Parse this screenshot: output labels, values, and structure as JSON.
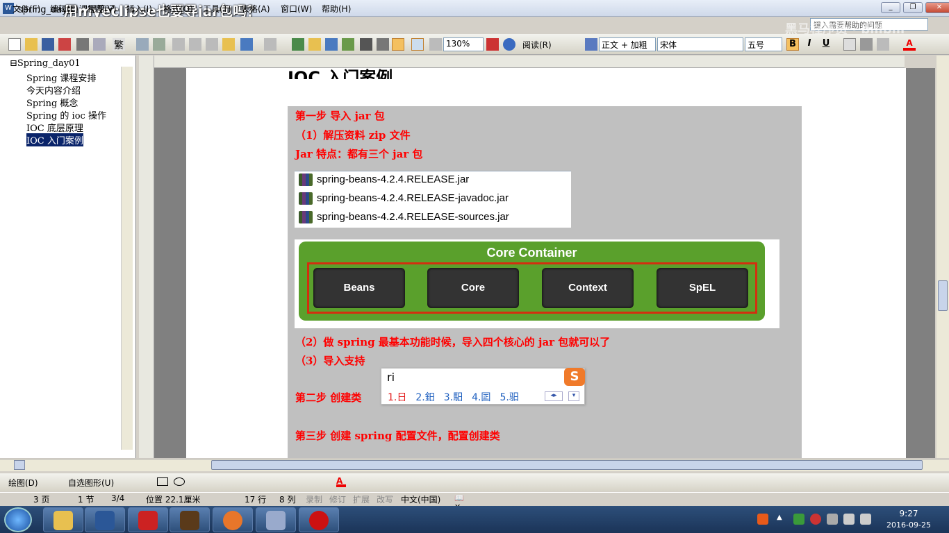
{
  "window": {
    "title": "spring_day01课程笔记",
    "overlay_title": "用myeclipse也要导jar包吗？",
    "minimize": "_",
    "maximize": "❐",
    "close": "✕"
  },
  "menu": [
    "文件(F)",
    "编辑(E)",
    "视图(V)",
    "插入(I)",
    "格式(O)",
    "工具(T)",
    "表格(A)",
    "窗口(W)",
    "帮助(H)"
  ],
  "help_box": "键入需要帮助的问题",
  "watermark": "黑马程序员 · bilibili",
  "toolbar": {
    "zoom": "130%",
    "read_btn": "阅读(R)",
    "style": "正文 + 加粗",
    "font": "宋体",
    "size": "五号",
    "bold": "B",
    "italic": "I",
    "underline": "U"
  },
  "doc_map": {
    "root": "⊟Spring_day01",
    "items": [
      "Spring 课程安排",
      "今天内容介绍",
      "Spring 概念",
      "Spring 的 ioc 操作",
      "IOC 底层原理",
      "IOC 入门案例"
    ],
    "selected_index": 5
  },
  "document": {
    "heading": "IOC 入门案例",
    "step1": "第一步  导入 jar 包",
    "step1_1": "（1）解压资料 zip 文件",
    "jar_feature": "Jar 特点：都有三个 jar 包",
    "jars": [
      "spring-beans-4.2.4.RELEASE.jar",
      "spring-beans-4.2.4.RELEASE-javadoc.jar",
      "spring-beans-4.2.4.RELEASE-sources.jar"
    ],
    "core_container": {
      "title": "Core Container",
      "modules": [
        "Beans",
        "Core",
        "Context",
        "SpEL"
      ]
    },
    "step1_2": "（2）做 spring 最基本功能时候，导入四个核心的 jar 包就可以了",
    "step1_3": "（3）导入支持",
    "step2": "第二步  创建类",
    "step3": "第三步  创建 spring 配置文件，配置创建类"
  },
  "ime": {
    "input": "ri",
    "candidates": [
      "1.日",
      "2.鈤",
      "3.馹",
      "4.囸",
      "5.驲"
    ]
  },
  "status": {
    "page": "3 页",
    "section": "1 节",
    "pages": "3/4",
    "position": "位置 22.1厘米",
    "line": "17 行",
    "col": "8 列",
    "rec": "录制",
    "trk": "修订",
    "ext": "扩展",
    "ovr": "改写",
    "lang": "中文(中国)"
  },
  "drawbar": {
    "draw": "绘图(D)",
    "autoshape": "自选图形(U)"
  },
  "taskbar": {
    "time": "9:27",
    "date": "2016-09-25"
  },
  "colors": {
    "red_text": "#ff0000",
    "core_green": "#5aa02c",
    "core_frame": "#d32f0f"
  }
}
